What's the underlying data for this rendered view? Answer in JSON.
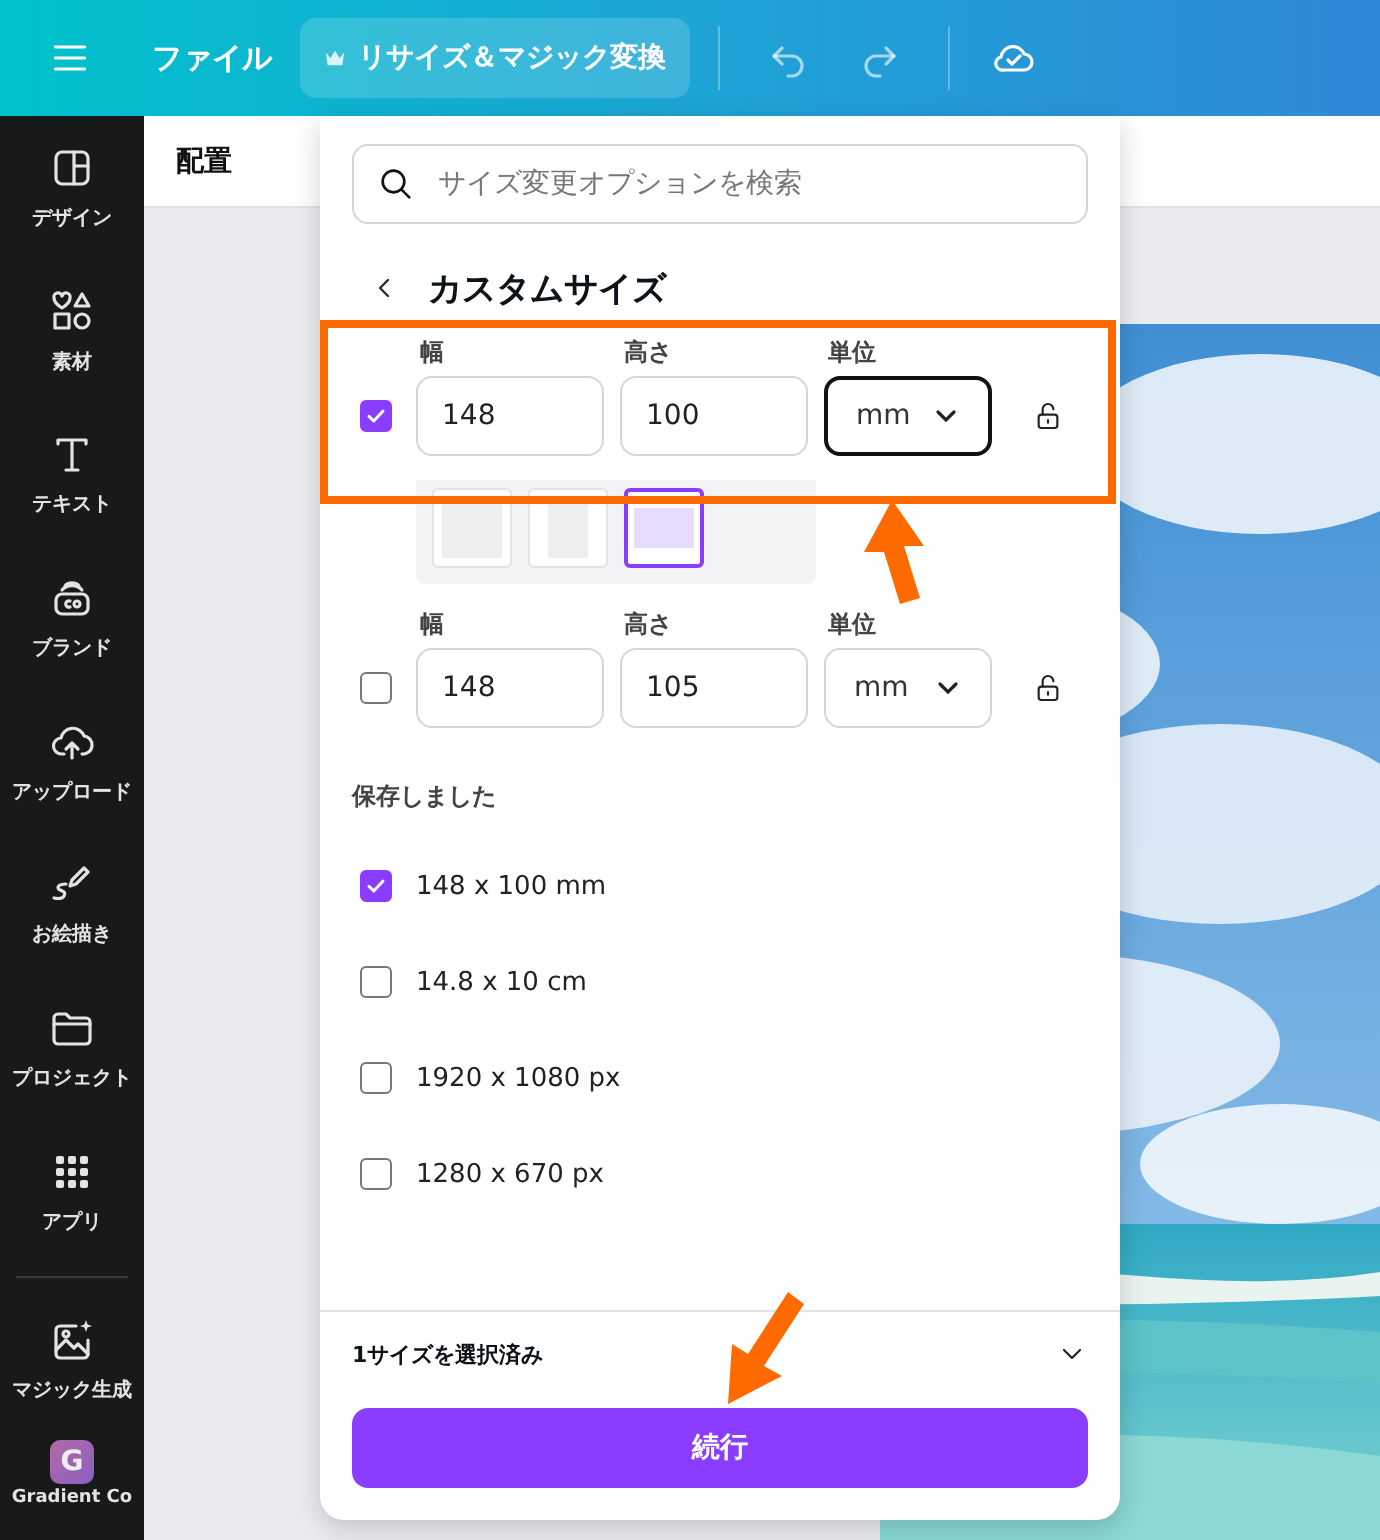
{
  "toolbar": {
    "file_menu": "ファイル",
    "resize_button": "リサイズ＆マジック変換"
  },
  "sidebar": {
    "items": [
      {
        "kind": "icon",
        "label": "デザイン"
      },
      {
        "kind": "icon",
        "label": "素材"
      },
      {
        "kind": "icon",
        "label": "テキスト"
      },
      {
        "kind": "icon",
        "label": "ブランド"
      },
      {
        "kind": "icon",
        "label": "アップロード"
      },
      {
        "kind": "icon",
        "label": "お絵描き"
      },
      {
        "kind": "icon",
        "label": "プロジェクト"
      },
      {
        "kind": "icon",
        "label": "アプリ"
      }
    ],
    "extra_items": [
      {
        "kind": "icon",
        "label": "マジック生成"
      },
      {
        "kind": "avatar",
        "avatar": "G",
        "label": "Gradient Co"
      }
    ]
  },
  "secondary_bar": {
    "label": "配置"
  },
  "resize_panel": {
    "search": {
      "placeholder": "サイズ変更オプションを検索"
    },
    "title": "カスタムサイズ",
    "size_rows": [
      {
        "checked": true,
        "width": {
          "label": "幅",
          "value": "148"
        },
        "height": {
          "label": "高さ",
          "value": "100"
        },
        "unit": {
          "label": "単位",
          "value": "mm",
          "focused": true
        },
        "orientations": [
          {
            "kind": "square",
            "selected": false
          },
          {
            "kind": "portrait",
            "selected": false
          },
          {
            "kind": "landscape",
            "selected": true
          }
        ]
      },
      {
        "checked": false,
        "width": {
          "label": "幅",
          "value": "148"
        },
        "height": {
          "label": "高さ",
          "value": "105"
        },
        "unit": {
          "label": "単位",
          "value": "mm",
          "focused": false
        }
      }
    ],
    "saved_heading": "保存しました",
    "saved_sizes": [
      {
        "label": "148 x 100 mm",
        "checked": true
      },
      {
        "label": "14.8 x 10 cm",
        "checked": false
      },
      {
        "label": "1920 x 1080 px",
        "checked": false
      },
      {
        "label": "1280 x 670 px",
        "checked": false
      }
    ],
    "footer": {
      "summary": "1サイズを選択済み",
      "continue_button": "続行"
    }
  }
}
